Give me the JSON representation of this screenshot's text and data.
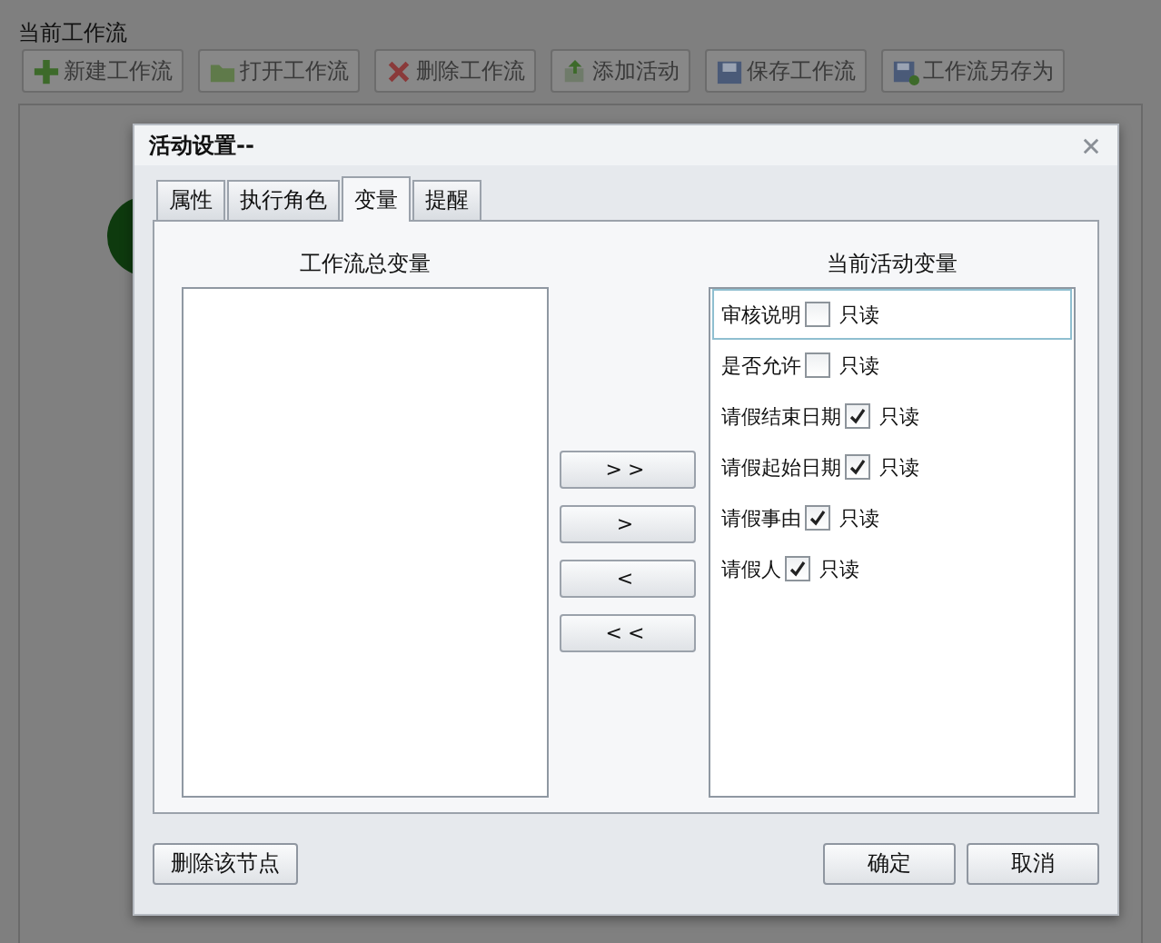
{
  "page": {
    "title": "当前工作流"
  },
  "toolbar": [
    {
      "label": "新建工作流",
      "kind": "new"
    },
    {
      "label": "打开工作流",
      "kind": "open"
    },
    {
      "label": "删除工作流",
      "kind": "delete"
    },
    {
      "label": "添加活动",
      "kind": "add"
    },
    {
      "label": "保存工作流",
      "kind": "save"
    },
    {
      "label": "工作流另存为",
      "kind": "save_as"
    }
  ],
  "dialog": {
    "title": "活动设置--",
    "tabs": [
      {
        "label": "属性",
        "selected": false
      },
      {
        "label": "执行角色",
        "selected": false
      },
      {
        "label": "变量",
        "selected": true
      },
      {
        "label": "提醒",
        "selected": false
      }
    ],
    "all_variables": {
      "heading": "工作流总变量"
    },
    "transfer_buttons": [
      ">>",
      ">",
      "<",
      "<<"
    ],
    "current_variables": {
      "heading": "当前活动变量",
      "items": [
        {
          "name": "审核说明",
          "readonly_label": "只读",
          "checked": false,
          "selected": true
        },
        {
          "name": "是否允许",
          "readonly_label": "只读",
          "checked": false,
          "selected": false
        },
        {
          "name": "请假结束日期",
          "readonly_label": "只读",
          "checked": true,
          "selected": false
        },
        {
          "name": "请假起始日期",
          "readonly_label": "只读",
          "checked": true,
          "selected": false
        },
        {
          "name": "请假事由",
          "readonly_label": "只读",
          "checked": true,
          "selected": false
        },
        {
          "name": "请假人",
          "readonly_label": "只读",
          "checked": true,
          "selected": false
        }
      ]
    },
    "buttons": {
      "delete": "删除该节点",
      "ok": "确定",
      "cancel": "取消"
    }
  }
}
